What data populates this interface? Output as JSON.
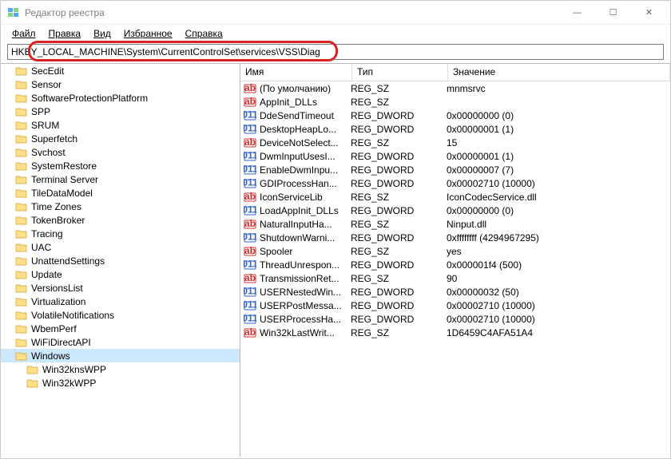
{
  "window": {
    "title": "Редактор реестра",
    "minimize": "—",
    "maximize": "☐",
    "close": "✕"
  },
  "menu": {
    "file": "Файл",
    "edit": "Правка",
    "view": "Вид",
    "favorites": "Избранное",
    "help": "Справка"
  },
  "address": "HKEY_LOCAL_MACHINE\\System\\CurrentControlSet\\services\\VSS\\Diag",
  "tree": [
    {
      "label": "SecEdit"
    },
    {
      "label": "Sensor"
    },
    {
      "label": "SoftwareProtectionPlatform"
    },
    {
      "label": "SPP"
    },
    {
      "label": "SRUM"
    },
    {
      "label": "Superfetch"
    },
    {
      "label": "Svchost"
    },
    {
      "label": "SystemRestore"
    },
    {
      "label": "Terminal Server"
    },
    {
      "label": "TileDataModel"
    },
    {
      "label": "Time Zones"
    },
    {
      "label": "TokenBroker"
    },
    {
      "label": "Tracing"
    },
    {
      "label": "UAC"
    },
    {
      "label": "UnattendSettings"
    },
    {
      "label": "Update"
    },
    {
      "label": "VersionsList"
    },
    {
      "label": "Virtualization"
    },
    {
      "label": "VolatileNotifications"
    },
    {
      "label": "WbemPerf"
    },
    {
      "label": "WiFiDirectAPI"
    },
    {
      "label": "Windows",
      "selected": true
    },
    {
      "label": "Win32knsWPP",
      "child": true
    },
    {
      "label": "Win32kWPP",
      "child": true
    }
  ],
  "columns": {
    "name": "Имя",
    "type": "Тип",
    "data": "Значение"
  },
  "values": [
    {
      "icon": "sz",
      "name": "(По умолчанию)",
      "type": "REG_SZ",
      "data": "mnmsrvc"
    },
    {
      "icon": "sz",
      "name": "AppInit_DLLs",
      "type": "REG_SZ",
      "data": ""
    },
    {
      "icon": "dw",
      "name": "DdeSendTimeout",
      "type": "REG_DWORD",
      "data": "0x00000000 (0)"
    },
    {
      "icon": "dw",
      "name": "DesktopHeapLo...",
      "type": "REG_DWORD",
      "data": "0x00000001 (1)"
    },
    {
      "icon": "sz",
      "name": "DeviceNotSelect...",
      "type": "REG_SZ",
      "data": "15"
    },
    {
      "icon": "dw",
      "name": "DwmInputUsesI...",
      "type": "REG_DWORD",
      "data": "0x00000001 (1)"
    },
    {
      "icon": "dw",
      "name": "EnableDwmInpu...",
      "type": "REG_DWORD",
      "data": "0x00000007 (7)"
    },
    {
      "icon": "dw",
      "name": "GDIProcessHan...",
      "type": "REG_DWORD",
      "data": "0x00002710 (10000)"
    },
    {
      "icon": "sz",
      "name": "IconServiceLib",
      "type": "REG_SZ",
      "data": "IconCodecService.dll"
    },
    {
      "icon": "dw",
      "name": "LoadAppInit_DLLs",
      "type": "REG_DWORD",
      "data": "0x00000000 (0)"
    },
    {
      "icon": "sz",
      "name": "NaturalInputHa...",
      "type": "REG_SZ",
      "data": "Ninput.dll"
    },
    {
      "icon": "dw",
      "name": "ShutdownWarni...",
      "type": "REG_DWORD",
      "data": "0xffffffff (4294967295)"
    },
    {
      "icon": "sz",
      "name": "Spooler",
      "type": "REG_SZ",
      "data": "yes"
    },
    {
      "icon": "dw",
      "name": "ThreadUnrespon...",
      "type": "REG_DWORD",
      "data": "0x000001f4 (500)"
    },
    {
      "icon": "sz",
      "name": "TransmissionRet...",
      "type": "REG_SZ",
      "data": "90"
    },
    {
      "icon": "dw",
      "name": "USERNestedWin...",
      "type": "REG_DWORD",
      "data": "0x00000032 (50)"
    },
    {
      "icon": "dw",
      "name": "USERPostMessa...",
      "type": "REG_DWORD",
      "data": "0x00002710 (10000)"
    },
    {
      "icon": "dw",
      "name": "USERProcessHa...",
      "type": "REG_DWORD",
      "data": "0x00002710 (10000)"
    },
    {
      "icon": "sz",
      "name": "Win32kLastWrit...",
      "type": "REG_SZ",
      "data": "1D6459C4AFA51A4"
    }
  ]
}
